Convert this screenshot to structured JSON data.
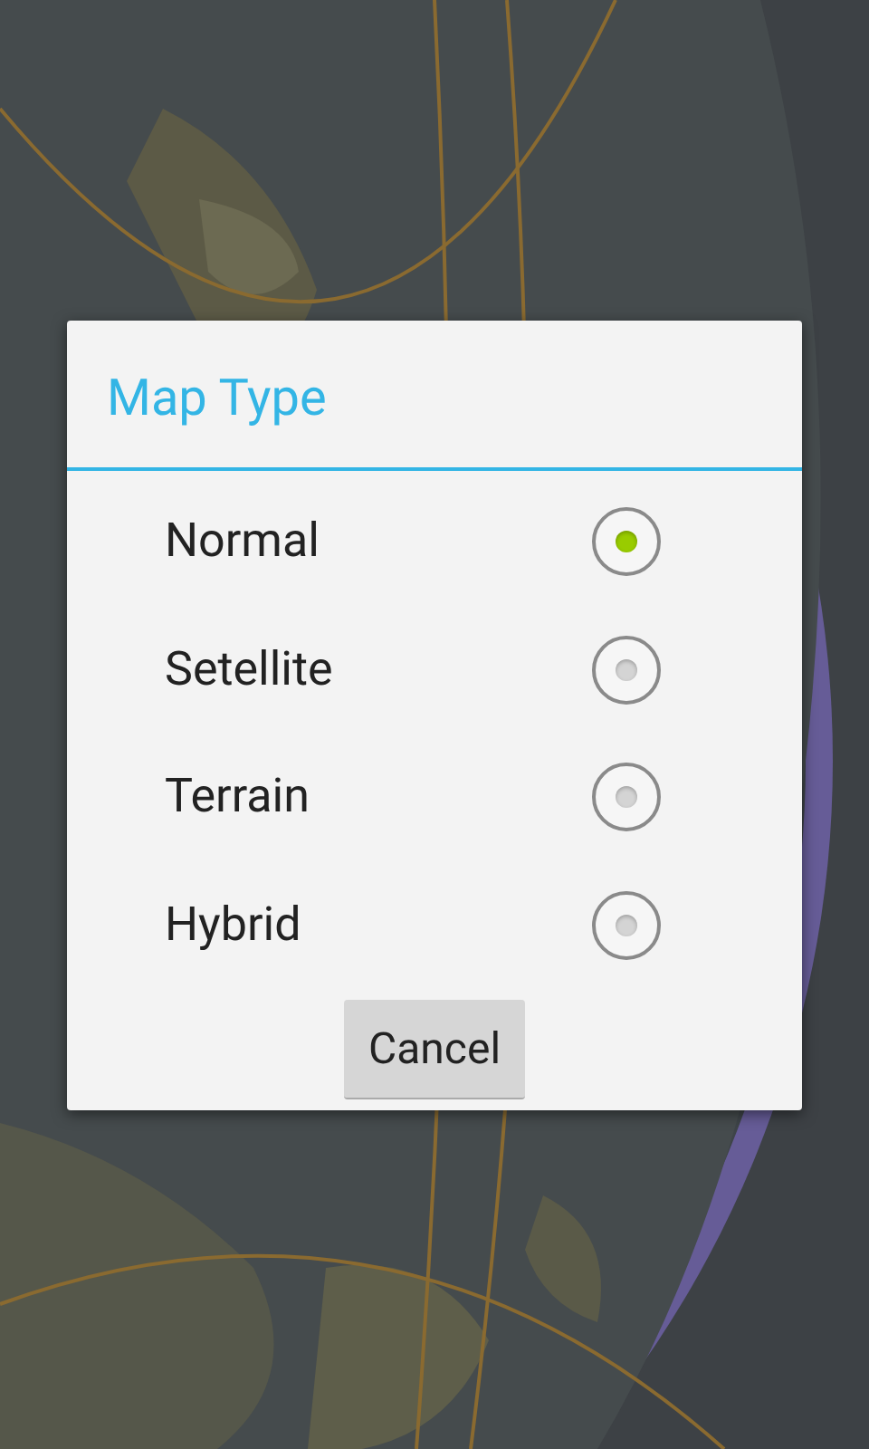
{
  "dialog": {
    "title": "Map Type",
    "options": [
      {
        "label": "Normal",
        "selected": true
      },
      {
        "label": "Setellite",
        "selected": false
      },
      {
        "label": "Terrain",
        "selected": false
      },
      {
        "label": "Hybrid",
        "selected": false
      }
    ],
    "buttons": [
      "Cancel"
    ]
  }
}
